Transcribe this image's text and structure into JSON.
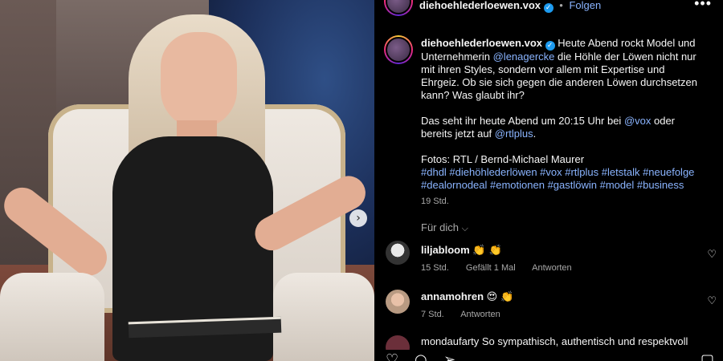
{
  "post": {
    "username": "diehoehlederloewen.vox",
    "separator": "•",
    "follow_label": "Folgen"
  },
  "caption": {
    "username": "diehoehlederloewen.vox",
    "text_1": " Heute Abend rockt Model und Unternehmerin ",
    "mention_1": "@lenagercke",
    "text_2": " die Höhle der Löwen nicht nur mit ihren Styles, sondern vor allem mit Expertise und Ehrgeiz. Ob sie sich gegen die anderen Löwen durchsetzen kann? Was glaubt ihr?",
    "para2_text_1": "Das seht ihr heute Abend um 20:15 Uhr bei ",
    "mention_2": "@vox",
    "para2_text_2": " oder bereits jetzt auf ",
    "mention_3": "@rtlplus",
    "para2_end": ".",
    "credits": "Fotos: RTL / Bernd-Michael Maurer",
    "hashtags": "#dhdl #diehöhlederlöwen #vox #rtlplus #letstalk #neuefolge #dealornodeal #emotionen #gastlöwin #model #business",
    "time": "19 Std."
  },
  "sort_label": "Für dich",
  "comments": [
    {
      "username": "liljabloom",
      "emoji": "👏 👏",
      "time": "15 Std.",
      "likes": "Gefällt 1 Mal",
      "reply": "Antworten"
    },
    {
      "username": "annamohren",
      "emoji": "😍 👏",
      "time": "7 Std.",
      "reply": "Antworten"
    }
  ],
  "cutoff_comment": "mondaufarty So sympathisch, authentisch und respektvoll",
  "icons": {
    "more": "more-horizontal-icon",
    "verified": "verified-badge-icon",
    "heart": "heart-icon",
    "chevron": "chevron-down-icon",
    "carousel_next": "chevron-right-icon",
    "comment": "comment-icon",
    "share": "share-icon",
    "save": "bookmark-icon"
  },
  "colors": {
    "link": "#8ab4ff",
    "verified": "#1d9bf0",
    "muted": "#a8a8a8",
    "background": "#000000"
  }
}
